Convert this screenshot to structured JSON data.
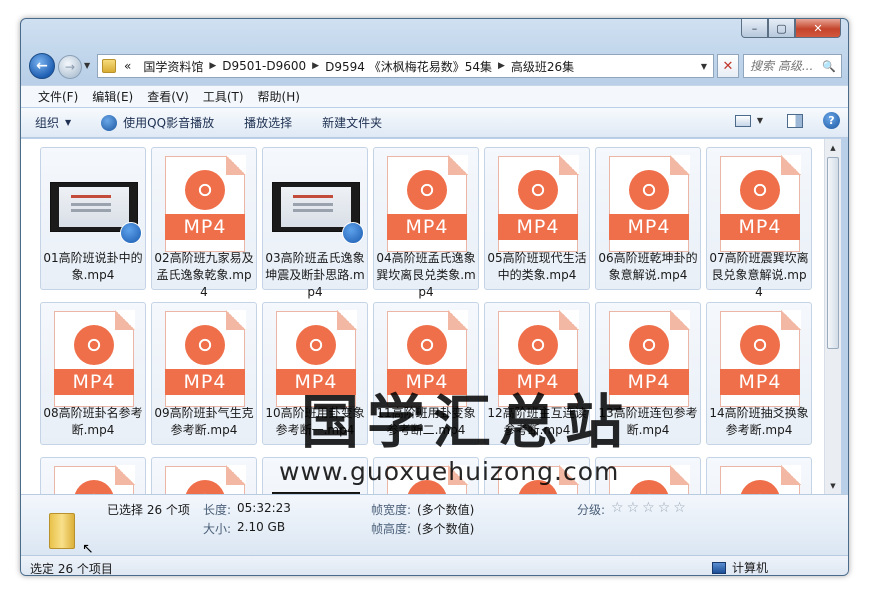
{
  "window": {
    "min": "–",
    "max": "▢",
    "close": "✕"
  },
  "address": {
    "overflow": "«",
    "crumbs": [
      "国学资料馆",
      "D9501-D9600",
      "D9594 《沐枫梅花易数》54集",
      "高级班26集"
    ],
    "clear": "✕",
    "search_placeholder": "搜索 高级..."
  },
  "menu": [
    "文件(F)",
    "编辑(E)",
    "查看(V)",
    "工具(T)",
    "帮助(H)"
  ],
  "toolbar": {
    "organize": "组织",
    "qq_play": "使用QQ影音播放",
    "play_selection": "播放选择",
    "new_folder": "新建文件夹"
  },
  "files": [
    {
      "name": "01高阶班说卦中的象.mp4",
      "thumb": "video"
    },
    {
      "name": "02高阶班九家易及孟氏逸象乾象.mp4",
      "thumb": "mp4"
    },
    {
      "name": "03高阶班孟氏逸象坤震及断卦思路.mp4",
      "thumb": "video"
    },
    {
      "name": "04高阶班孟氏逸象巽坎离艮兑类象.mp4",
      "thumb": "mp4"
    },
    {
      "name": "05高阶班现代生活中的类象.mp4",
      "thumb": "mp4"
    },
    {
      "name": "06高阶班乾坤卦的象意解说.mp4",
      "thumb": "mp4"
    },
    {
      "name": "07高阶班震巽坎离艮兑象意解说.mp4",
      "thumb": "mp4"
    },
    {
      "name": "08高阶班卦名参考断.mp4",
      "thumb": "mp4"
    },
    {
      "name": "09高阶班卦气生克参考断.mp4",
      "thumb": "mp4"
    },
    {
      "name": "10高阶班用卦变象参考断一.mp4",
      "thumb": "mp4"
    },
    {
      "name": "11高阶班用卦变象参考断二.mp4",
      "thumb": "mp4"
    },
    {
      "name": "12高阶班主互连读参考断.mp4",
      "thumb": "mp4"
    },
    {
      "name": "13高阶班连包参考断.mp4",
      "thumb": "mp4"
    },
    {
      "name": "14高阶班抽爻换象参考断.mp4",
      "thumb": "mp4"
    },
    {
      "name": "",
      "thumb": "mp4"
    },
    {
      "name": "",
      "thumb": "mp4"
    },
    {
      "name": "",
      "thumb": "video"
    },
    {
      "name": "",
      "thumb": "mp4"
    },
    {
      "name": "",
      "thumb": "mp4"
    },
    {
      "name": "",
      "thumb": "mp4"
    },
    {
      "name": "",
      "thumb": "mp4"
    }
  ],
  "mp4_label": "MP4",
  "watermark": {
    "title": "国学汇总站",
    "url": "www.guoxuehuizong.com"
  },
  "details": {
    "selected": "已选择 26 个项",
    "length_label": "长度:",
    "length_value": "05:32:23",
    "size_label": "大小:",
    "size_value": "2.10 GB",
    "frame_width_label": "帧宽度:",
    "frame_width_value": "(多个数值)",
    "frame_height_label": "帧高度:",
    "frame_height_value": "(多个数值)",
    "rating_label": "分级:",
    "rating_stars": 0
  },
  "status": {
    "left": "选定 26 个项目",
    "computer": "计算机"
  },
  "scroll": {
    "up": "▲",
    "down": "▼"
  }
}
